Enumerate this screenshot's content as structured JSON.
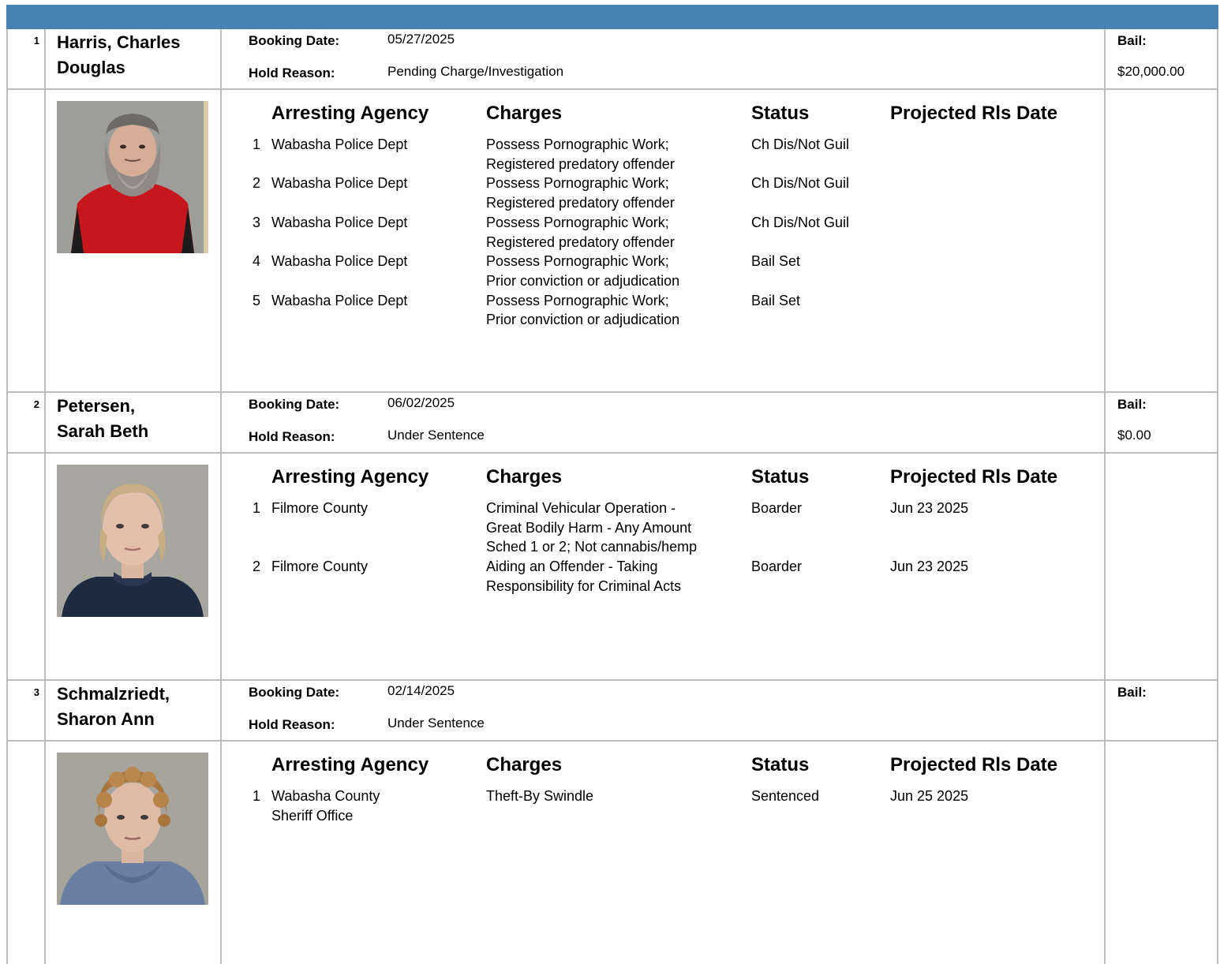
{
  "columns": {
    "agency": "Arresting Agency",
    "charges": "Charges",
    "status": "Status",
    "release": "Projected Rls Date"
  },
  "labels": {
    "booking": "Booking Date:",
    "hold": "Hold Reason:",
    "bail": "Bail:"
  },
  "inmates": [
    {
      "num": "1",
      "name": "Harris, Charles Douglas",
      "booking_date": "05/27/2025",
      "hold_reason": "Pending Charge/Investigation",
      "bail": "$20,000.00",
      "photo": "mugshot-man-red-shirt",
      "charges": [
        {
          "n": "1",
          "agency": "Wabasha Police Dept",
          "charge": "Possess Pornographic Work;\nRegistered predatory offender",
          "status": "Ch Dis/Not Guil",
          "release": ""
        },
        {
          "n": "2",
          "agency": "Wabasha Police Dept",
          "charge": "Possess Pornographic Work;\nRegistered predatory offender",
          "status": "Ch Dis/Not Guil",
          "release": ""
        },
        {
          "n": "3",
          "agency": "Wabasha Police Dept",
          "charge": "Possess Pornographic Work;\nRegistered predatory offender",
          "status": "Ch Dis/Not Guil",
          "release": ""
        },
        {
          "n": "4",
          "agency": "Wabasha Police Dept",
          "charge": "Possess Pornographic Work;\nPrior conviction or adjudication",
          "status": "Bail Set",
          "release": ""
        },
        {
          "n": "5",
          "agency": "Wabasha Police Dept",
          "charge": "Possess Pornographic Work;\nPrior conviction or adjudication",
          "status": "Bail Set",
          "release": ""
        }
      ]
    },
    {
      "num": "2",
      "name": "Petersen,\nSarah Beth",
      "booking_date": "06/02/2025",
      "hold_reason": "Under Sentence",
      "bail": "$0.00",
      "photo": "mugshot-woman-blonde",
      "charges": [
        {
          "n": "1",
          "agency": "Filmore County",
          "charge": "Criminal Vehicular Operation -\nGreat Bodily Harm - Any Amount\nSched 1 or 2; Not cannabis/hemp",
          "status": "Boarder",
          "release": "Jun 23 2025"
        },
        {
          "n": "2",
          "agency": "Filmore County",
          "charge": "Aiding an Offender - Taking\nResponsibility for Criminal Acts",
          "status": "Boarder",
          "release": "Jun 23 2025"
        }
      ]
    },
    {
      "num": "3",
      "name": "Schmalzriedt,\nSharon Ann",
      "booking_date": "02/14/2025",
      "hold_reason": "Under Sentence",
      "bail": "",
      "photo": "mugshot-woman-curly-hair",
      "charges": [
        {
          "n": "1",
          "agency": "Wabasha County\nSheriff Office",
          "charge": "Theft-By Swindle",
          "status": "Sentenced",
          "release": "Jun 25 2025"
        }
      ]
    }
  ]
}
